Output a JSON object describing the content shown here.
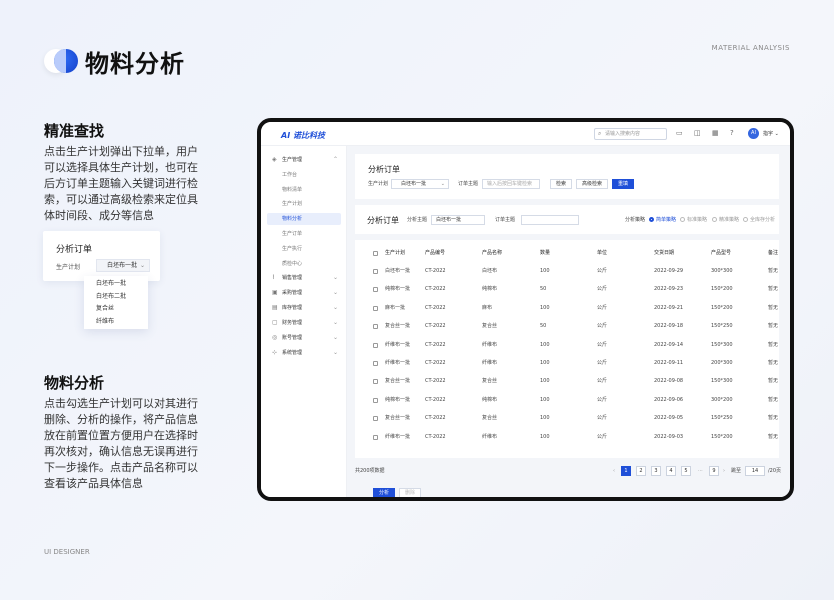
{
  "page": {
    "title": "物料分析",
    "en_tag": "MATERIAL ANALYSIS",
    "footer": "UI DESIGNER"
  },
  "section1": {
    "title": "精准查找",
    "body": "点击生产计划弹出下拉单，用户可以选择具体生产计划，也可在后方订单主题输入关键词进行检索，可以通过高级检索来定位具体时间段、成分等信息"
  },
  "section2": {
    "title": "物料分析",
    "body": "点击勾选生产计划可以对其进行删除、分析的操作，将产品信息放在前置位置方便用户在选择时再次核对，确认信息无误再进行下一步操作。点击产品名称可以查看该产品具体信息"
  },
  "popup": {
    "title": "分析订单",
    "label": "生产计划",
    "value": "白坯布一批",
    "options": [
      "白坯布一批",
      "白坯布二批",
      "复合丝",
      "纤维布"
    ]
  },
  "app": {
    "brand": "诺比科技",
    "search_placeholder": "请输入搜索内容",
    "user": "指宇",
    "avatar_text": "AI",
    "sidebar": {
      "group_open": "生产管理",
      "sub_items": [
        "工作台",
        "物料清单",
        "生产计划",
        "物料分析",
        "生产订单",
        "生产执行",
        "质检中心"
      ],
      "active": "物料分析",
      "groups": [
        "销售管理",
        "采购管理",
        "库存管理",
        "财务管理",
        "账号管理",
        "系统管理"
      ]
    },
    "filter": {
      "title": "分析订单",
      "plan_label": "生产计划",
      "plan_value": "白坯布一批",
      "topic_label": "订单主题",
      "topic_placeholder": "输入后按回车键检索",
      "search_btn": "检索",
      "advanced_btn": "高级检索",
      "reset_btn": "重填"
    },
    "analysis": {
      "title": "分析订单",
      "plan_label": "分析主题",
      "plan_value": "白坯布一批",
      "topic_label": "订单主题",
      "strategy_label": "分析策略",
      "strategies": [
        "简单策略",
        "标准策略",
        "精准策略",
        "全库存分析"
      ],
      "selected_strategy": "简单策略"
    },
    "table": {
      "headers": [
        "生产计划",
        "产品编号",
        "产品名称",
        "数量",
        "单位",
        "交货日期",
        "产品型号",
        "备注"
      ],
      "rows": [
        [
          "白坯布一批",
          "CT-2022",
          "白坯布",
          "100",
          "公斤",
          "2022-09-29",
          "300*300",
          "暂无"
        ],
        [
          "纯棉布一批",
          "CT-2022",
          "纯棉布",
          "50",
          "公斤",
          "2022-09-23",
          "150*200",
          "暂无"
        ],
        [
          "麻布一批",
          "CT-2022",
          "麻布",
          "100",
          "公斤",
          "2022-09-21",
          "150*200",
          "暂无"
        ],
        [
          "复合丝一批",
          "CT-2022",
          "复合丝",
          "50",
          "公斤",
          "2022-09-18",
          "150*250",
          "暂无"
        ],
        [
          "纤维布一批",
          "CT-2022",
          "纤维布",
          "100",
          "公斤",
          "2022-09-14",
          "150*300",
          "暂无"
        ],
        [
          "纤维布一批",
          "CT-2022",
          "纤维布",
          "100",
          "公斤",
          "2022-09-11",
          "200*300",
          "暂无"
        ],
        [
          "复合丝一批",
          "CT-2022",
          "复合丝",
          "100",
          "公斤",
          "2022-09-08",
          "150*300",
          "暂无"
        ],
        [
          "纯棉布一批",
          "CT-2022",
          "纯棉布",
          "100",
          "公斤",
          "2022-09-06",
          "300*200",
          "暂无"
        ],
        [
          "复合丝一批",
          "CT-2022",
          "复合丝",
          "100",
          "公斤",
          "2022-09-05",
          "150*250",
          "暂无"
        ],
        [
          "纤维布一批",
          "CT-2022",
          "纤维布",
          "100",
          "公斤",
          "2022-09-03",
          "150*200",
          "暂无"
        ]
      ]
    },
    "pager": {
      "total": "共200项数据",
      "pages": [
        "1",
        "2",
        "3",
        "4",
        "5"
      ],
      "current": "1",
      "ellipsis": "···",
      "last": "9",
      "jump_label": "跳至",
      "jump_value": "14",
      "total_pages": "/20页",
      "prev": "‹",
      "next": "›"
    },
    "actions": {
      "analyze": "分析",
      "delete": "删除"
    }
  },
  "colors": {
    "accent": "#1f4fd8"
  }
}
